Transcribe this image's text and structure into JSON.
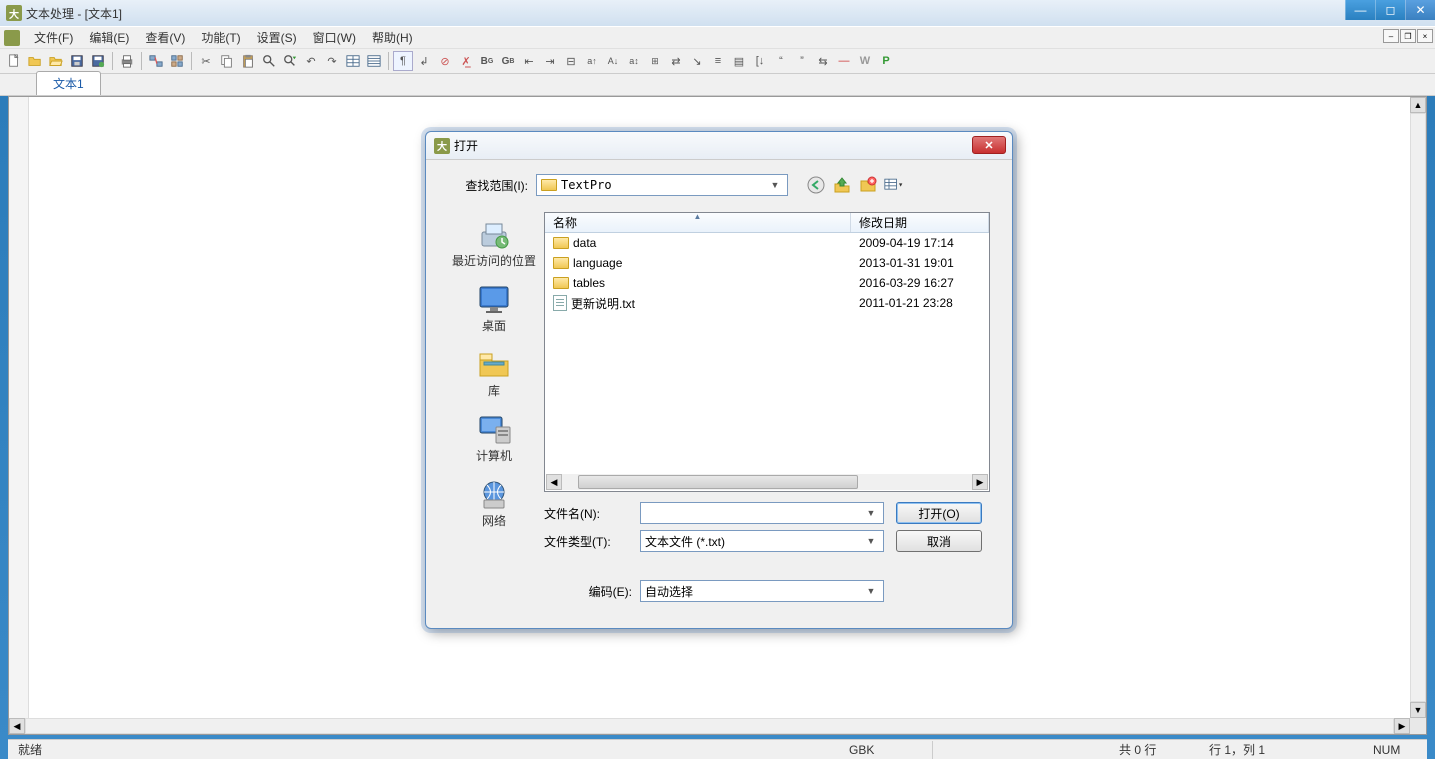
{
  "app": {
    "title": "文本处理 - [文本1]",
    "icon_letter": "大"
  },
  "menubar": {
    "items": [
      "文件(F)",
      "编辑(E)",
      "查看(V)",
      "功能(T)",
      "设置(S)",
      "窗口(W)",
      "帮助(H)"
    ]
  },
  "tabs": {
    "active": "文本1"
  },
  "statusbar": {
    "ready": "就绪",
    "encoding": "GBK",
    "lines": "共 0 行",
    "position": "行 1，列 1",
    "numlock": "NUM"
  },
  "dialog": {
    "title": "打开",
    "lookin_label": "查找范围(I):",
    "lookin_value": "TextPro",
    "places": [
      {
        "label": "最近访问的位置",
        "icon": "recent"
      },
      {
        "label": "桌面",
        "icon": "desktop"
      },
      {
        "label": "库",
        "icon": "libraries"
      },
      {
        "label": "计算机",
        "icon": "computer"
      },
      {
        "label": "网络",
        "icon": "network"
      }
    ],
    "columns": {
      "name": "名称",
      "date": "修改日期"
    },
    "files": [
      {
        "name": "data",
        "date": "2009-04-19 17:14",
        "type": "folder"
      },
      {
        "name": "language",
        "date": "2013-01-31 19:01",
        "type": "folder"
      },
      {
        "name": "tables",
        "date": "2016-03-29 16:27",
        "type": "folder"
      },
      {
        "name": "更新说明.txt",
        "date": "2011-01-21 23:28",
        "type": "file"
      }
    ],
    "filename_label": "文件名(N):",
    "filename_value": "",
    "filetype_label": "文件类型(T):",
    "filetype_value": "文本文件 (*.txt)",
    "encoding_label": "编码(E):",
    "encoding_value": "自动选择",
    "open_btn": "打开(O)",
    "cancel_btn": "取消"
  }
}
